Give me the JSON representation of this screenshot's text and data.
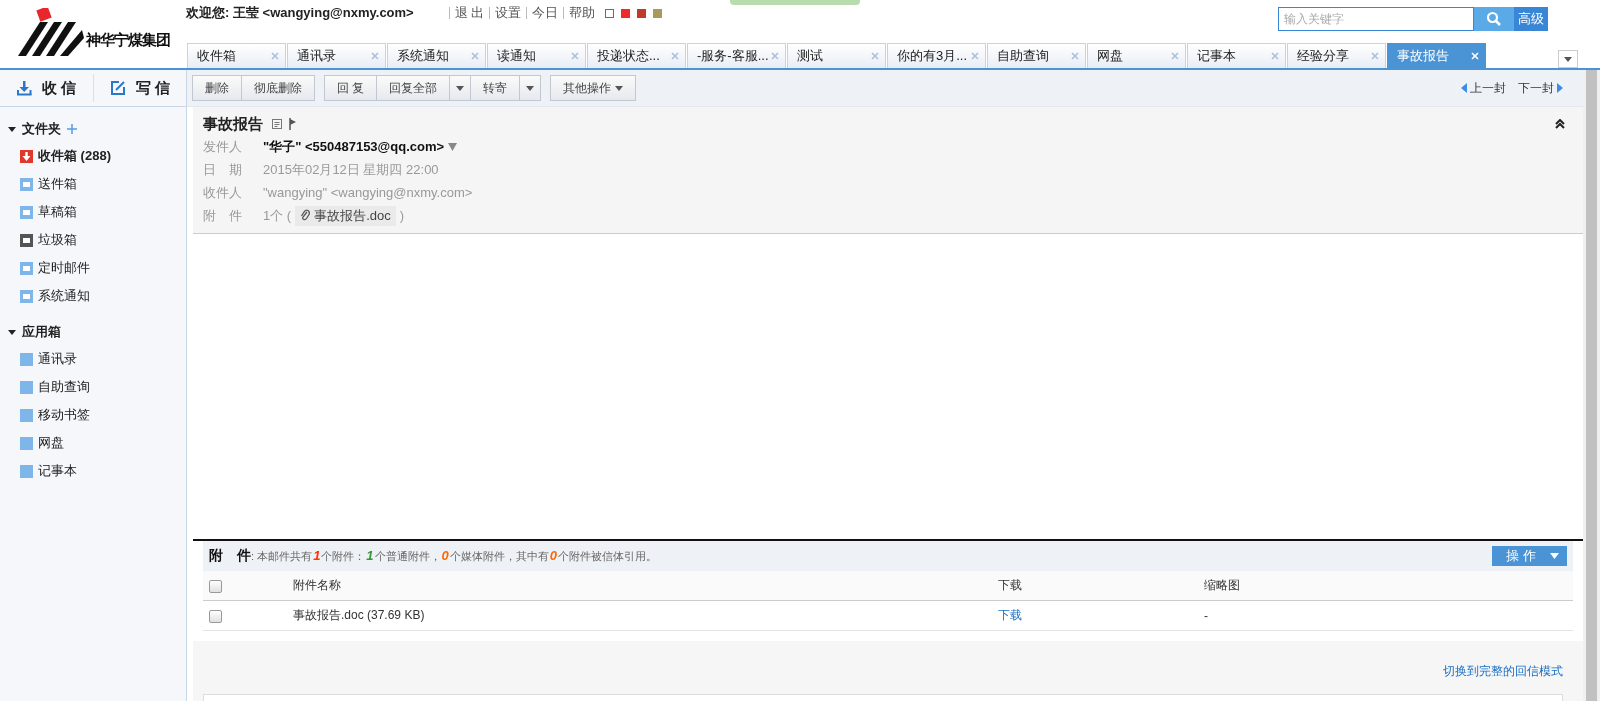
{
  "header": {
    "logo_text": "神华宁煤集团",
    "welcome": "欢迎您: 王莹 <wangying@nxmy.com>",
    "links": [
      "退 出",
      "设置",
      "今日",
      "帮助"
    ],
    "skins": [
      {
        "color": "#1e7be0",
        "kind": "outline"
      },
      {
        "color": "#ee2a2a",
        "kind": "solid"
      },
      {
        "color": "#c0392b",
        "kind": "split"
      },
      {
        "color": "#a89a5a",
        "kind": "ring"
      }
    ],
    "search": {
      "placeholder": "输入关键字",
      "advanced": "高级"
    }
  },
  "tabs": [
    {
      "label": "收件箱",
      "selected": false
    },
    {
      "label": "通讯录",
      "selected": false
    },
    {
      "label": "系统通知",
      "selected": false
    },
    {
      "label": "读通知",
      "selected": false
    },
    {
      "label": "投递状态...",
      "selected": false
    },
    {
      "label": "-服务-客服...",
      "selected": false
    },
    {
      "label": "测试",
      "selected": false
    },
    {
      "label": "你的有3月...",
      "selected": false
    },
    {
      "label": "自助查询",
      "selected": false
    },
    {
      "label": "网盘",
      "selected": false
    },
    {
      "label": "记事本",
      "selected": false
    },
    {
      "label": "经验分享",
      "selected": false
    },
    {
      "label": "事故报告",
      "selected": true
    }
  ],
  "mail_actions": [
    {
      "label": "收 信",
      "kind": "receive"
    },
    {
      "label": "写 信",
      "kind": "compose"
    }
  ],
  "toolbar": [
    [
      {
        "label": "删除",
        "kind": "button"
      },
      {
        "label": "彻底删除",
        "kind": "button"
      }
    ],
    [
      {
        "label": "回 复",
        "kind": "button"
      },
      {
        "label": "回复全部",
        "kind": "button"
      },
      {
        "kind": "caret"
      },
      {
        "label": "转寄",
        "kind": "button"
      },
      {
        "kind": "caret"
      }
    ],
    [
      {
        "label": "其他操作",
        "kind": "menu"
      }
    ]
  ],
  "nav": {
    "prev": "上一封",
    "next": "下一封"
  },
  "sidebar": [
    {
      "title": "文件夹",
      "expanded": true,
      "addable": true,
      "items": [
        {
          "label": "收件箱",
          "count": "(288)",
          "kind": "inbox"
        },
        {
          "label": "送件箱",
          "kind": "folder"
        },
        {
          "label": "草稿箱",
          "kind": "folder"
        },
        {
          "label": "垃圾箱",
          "kind": "trash"
        },
        {
          "label": "定时邮件",
          "kind": "folder"
        },
        {
          "label": "系统通知",
          "kind": "folder"
        }
      ]
    },
    {
      "title": "应用箱",
      "expanded": true,
      "addable": false,
      "items": [
        {
          "label": "通讯录",
          "kind": "app"
        },
        {
          "label": "自助查询",
          "kind": "app"
        },
        {
          "label": "移动书签",
          "kind": "app"
        },
        {
          "label": "网盘",
          "kind": "app"
        },
        {
          "label": "记事本",
          "kind": "app"
        }
      ]
    }
  ],
  "message": {
    "subject": "事故报告",
    "fields": [
      {
        "label": "发件人",
        "value": "\"华子\" <550487153@qq.com>",
        "kind": "sender"
      },
      {
        "label": "日　期",
        "value": "2015年02月12日 星期四 22:00",
        "kind": "text"
      },
      {
        "label": "收件人",
        "value": "\"wangying\" <wangying@nxmy.com>",
        "kind": "text"
      },
      {
        "label": "附　件",
        "value": "1个 (",
        "file": "事故报告.doc",
        "close": ")",
        "kind": "attachment"
      }
    ]
  },
  "attachments": {
    "title": "附　件",
    "summary": [
      {
        "text": ": 本邮件共有"
      },
      {
        "text": "1",
        "color": "#ff3300"
      },
      {
        "text": "个附件："
      },
      {
        "text": "1",
        "color": "#339933"
      },
      {
        "text": "个普通附件，"
      },
      {
        "text": "0",
        "color": "#ff6600"
      },
      {
        "text": "个媒体附件，其中有"
      },
      {
        "text": "0",
        "color": "#ff6600"
      },
      {
        "text": "个附件被信体引用。"
      }
    ],
    "action": "操 作",
    "select_all": {
      "checked": false
    },
    "columns": [
      "附件名称",
      "下载",
      "缩略图"
    ],
    "rows": [
      {
        "checked": false,
        "name": "事故报告.doc (37.69 KB)",
        "download": "下载",
        "thumbnail": "-"
      }
    ]
  },
  "footer_link": "切换到完整的回信模式"
}
